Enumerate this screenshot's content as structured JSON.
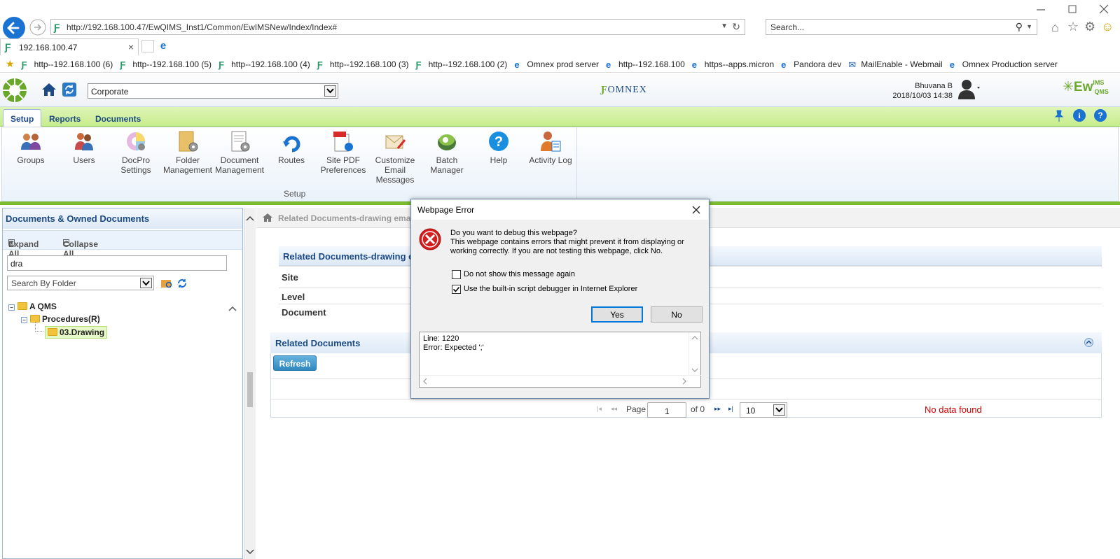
{
  "browser": {
    "url": "http://192.168.100.47/EwQIMS_Inst1/Common/EwIMSNew/Index/Index#",
    "search_placeholder": "Search...",
    "tab_title": "192.168.100.47",
    "favorites": [
      "http--192.168.100 (6)",
      "http--192.168.100 (5)",
      "http--192.168.100 (4)",
      "http--192.168.100 (3)",
      "http--192.168.100 (2)",
      "Omnex prod server",
      "http--192.168.100",
      "https--apps.micron",
      "Pandora dev",
      "MailEnable - Webmail",
      "Omnex Production server"
    ]
  },
  "header": {
    "site_select": "Corporate",
    "logo_text": "OMNEX",
    "user_name": "Bhuvana B",
    "datetime": "2018/10/03 14:38",
    "brand": "EwQIMS",
    "brand_main": "Ew",
    "brand_sup": "IMS",
    "brand_sub": "QMS"
  },
  "ribbon": {
    "tabs": [
      "Setup",
      "Reports",
      "Documents"
    ],
    "active_tab": "Setup",
    "buttons": [
      {
        "label": "Groups"
      },
      {
        "label": "Users"
      },
      {
        "label": "DocPro Settings"
      },
      {
        "label": "Folder Management"
      },
      {
        "label": "Document Management"
      },
      {
        "label": "Routes"
      },
      {
        "label": "Site PDF Preferences"
      },
      {
        "label": "Customize Email Messages"
      },
      {
        "label": "Batch Manager"
      },
      {
        "label": "Help"
      },
      {
        "label": "Activity Log"
      }
    ],
    "group_label": "Setup",
    "colors": {
      "tab_bar": "#c7ec8c",
      "accent_line": "#7bbb2f"
    }
  },
  "left_panel": {
    "title": "Documents & Owned Documents",
    "expand_all": "Expand All",
    "collapse_all": "Collapse All",
    "filter_value": "dra",
    "search_mode": "Search By Folder",
    "tree": [
      {
        "label": "A QMS",
        "level": 0
      },
      {
        "label": "Procedures(R)",
        "level": 1
      },
      {
        "label": "03.Drawing",
        "level": 2,
        "selected": true
      }
    ]
  },
  "main": {
    "breadcrumb": "Related Documents-drawing email",
    "details_title": "Related Documents-drawing email",
    "fields": [
      "Site",
      "Level",
      "Document"
    ],
    "related_title": "Related Documents",
    "refresh_label": "Refresh",
    "pager": {
      "page_label": "Page",
      "page_value": "1",
      "of_label": "of 0",
      "page_size": "10"
    },
    "no_data": "No data found"
  },
  "dialog": {
    "title": "Webpage Error",
    "question": "Do you want to debug this webpage?",
    "message": "This webpage contains errors that might prevent it from displaying or working correctly. If you are not testing this webpage, click No.",
    "chk_dont_show": "Do not show this message again",
    "chk_debugger": "Use the built-in script debugger in Internet Explorer",
    "yes_label": "Yes",
    "no_label": "No",
    "error_line": "Line: 1220",
    "error_text": "Error: Expected ';'"
  }
}
